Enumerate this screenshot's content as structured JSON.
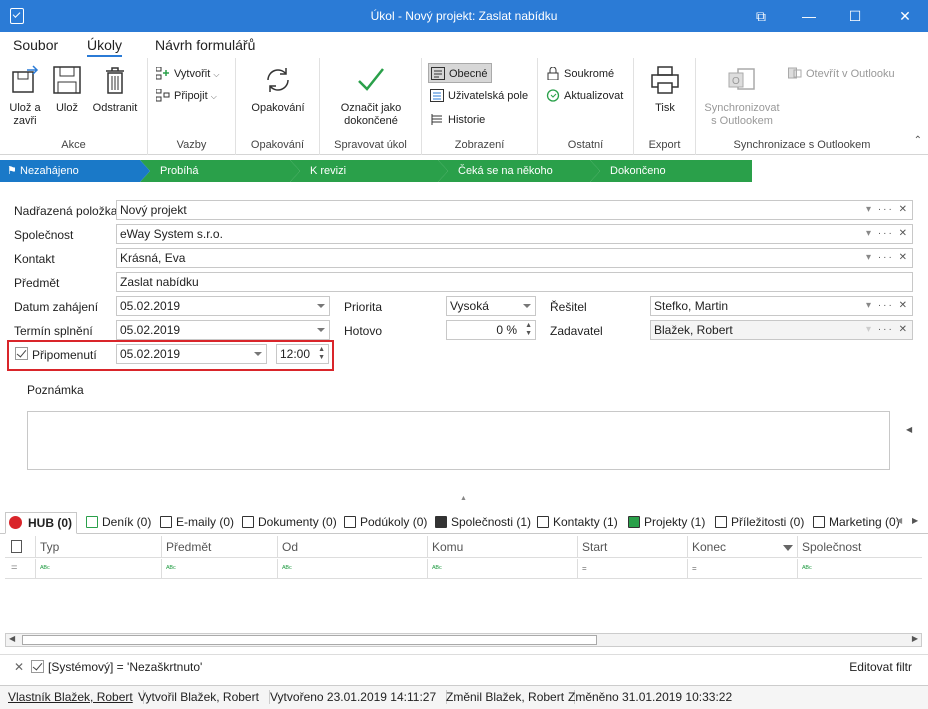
{
  "window": {
    "title": "Úkol - Nový projekt: Zaslat nabídku",
    "controls": [
      "⧉",
      "—",
      "☐",
      "✕"
    ]
  },
  "ribbon_tabs": [
    "Soubor",
    "Úkoly",
    "Návrh formulářů"
  ],
  "ribbon": {
    "akce": {
      "label": "Akce",
      "save_close": "Ulož a zavři",
      "save": "Ulož",
      "delete": "Odstranit"
    },
    "vazby": {
      "label": "Vazby",
      "create": "Vytvořit",
      "attach": "Připojit"
    },
    "opakovani": {
      "label": "Opakování",
      "recurrence": "Opakování"
    },
    "spravovat": {
      "label": "Spravovat úkol",
      "mark_done": "Označit jako dokončené"
    },
    "zobrazeni": {
      "label": "Zobrazení",
      "general": "Obecné",
      "user_fields": "Uživatelská pole",
      "history": "Historie"
    },
    "ostatni": {
      "label": "Ostatní",
      "private": "Soukromé",
      "refresh": "Aktualizovat"
    },
    "export": {
      "label": "Export",
      "print": "Tisk"
    },
    "sync": {
      "label": "Synchronizace s Outlookem",
      "sync_btn": "Synchronizovat s Outlookem",
      "open_outlook": "Otevřít v Outlooku"
    }
  },
  "steps": [
    "Nezahájeno",
    "Probíhá",
    "K revizi",
    "Čeká se na někoho dalšího",
    "Dokončeno"
  ],
  "form": {
    "parent_label": "Nadřazená položka",
    "parent_value": "Nový projekt",
    "company_label": "Společnost",
    "company_value": "eWay System s.r.o.",
    "contact_label": "Kontakt",
    "contact_value": "Krásná, Eva",
    "subject_label": "Předmět",
    "subject_value": "Zaslat nabídku",
    "start_label": "Datum zahájení",
    "start_value": "05.02.2019",
    "due_label": "Termín splnění",
    "due_value": "05.02.2019",
    "reminder_label": "Připomenutí",
    "reminder_date": "05.02.2019",
    "reminder_time": "12:00",
    "priority_label": "Priorita",
    "priority_value": "Vysoká",
    "done_label": "Hotovo",
    "done_value": "0 %",
    "solver_label": "Řešitel",
    "solver_value": "Stefko, Martin",
    "assigner_label": "Zadavatel",
    "assigner_value": "Blažek, Robert",
    "note_label": "Poznámka",
    "field_tools": "··· ✕"
  },
  "bottom_tabs": [
    "HUB (0)",
    "Deník (0)",
    "E-maily (0)",
    "Dokumenty (0)",
    "Podúkoly (0)",
    "Společnosti (1)",
    "Kontakty (1)",
    "Projekty (1)",
    "Příležitosti (0)",
    "Marketing (0)"
  ],
  "grid": {
    "columns": [
      "Typ",
      "Předmět",
      "Od",
      "Komu",
      "Start",
      "Konec",
      "Společnost"
    ],
    "filter_text": "ᴬᴮᶜ"
  },
  "filter": {
    "text": "[Systémový] = 'Nezaškrtnuto'",
    "edit": "Editovat filtr"
  },
  "status": {
    "owner": "Vlastník Blažek, Robert",
    "created_by": "Vytvořil Blažek, Robert",
    "created": "Vytvořeno 23.01.2019 14:11:27",
    "changed_by": "Změnil Blažek, Robert",
    "changed": "Změněno 31.01.2019 10:33:22"
  },
  "colors": {
    "titlebar": "#2b7bd6",
    "step_active": "#1a79c8",
    "step": "#2aa04a",
    "highlight": "#d9252a"
  }
}
